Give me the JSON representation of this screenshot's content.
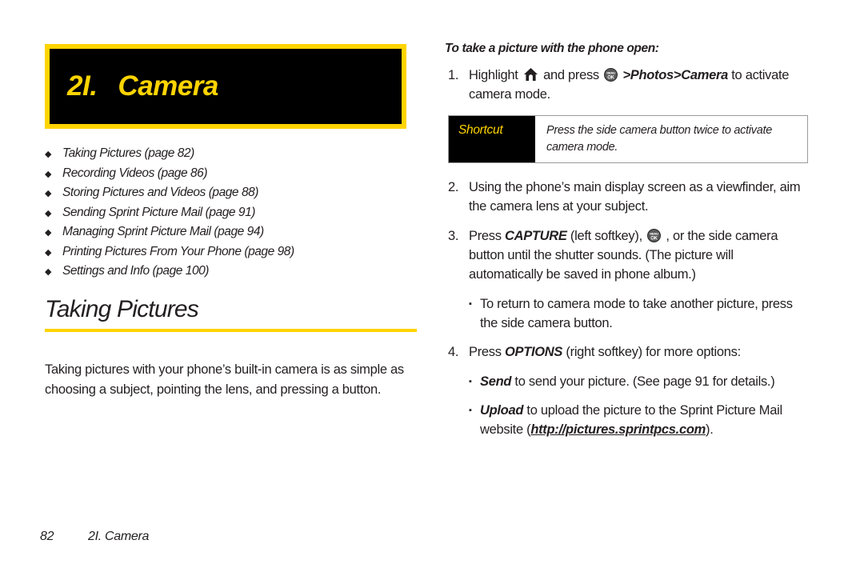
{
  "chapter": {
    "number": "2I.",
    "title": "Camera",
    "banner_bg": "#000000",
    "banner_border": "#FFD400",
    "banner_text_color": "#FFD400"
  },
  "toc": {
    "bullet_glyph": "◆",
    "items": [
      {
        "label": "Taking Pictures (page 82)"
      },
      {
        "label": "Recording Videos (page 86)"
      },
      {
        "label": "Storing Pictures and Videos (page 88)"
      },
      {
        "label": "Sending Sprint Picture Mail (page 91)"
      },
      {
        "label": "Managing Sprint Picture Mail (page 94)"
      },
      {
        "label": "Printing Pictures From Your Phone (page 98)"
      },
      {
        "label": "Settings and Info (page 100)"
      }
    ]
  },
  "section": {
    "title": "Taking Pictures",
    "rule_color": "#FFD400",
    "body": "Taking pictures with your phone’s built-in camera is as simple as choosing a subject, pointing the lens, and pressing a button."
  },
  "procedure": {
    "intro": "To take a picture with the phone open:",
    "steps": [
      {
        "number": "1.",
        "parts": [
          {
            "type": "text",
            "value": "Highlight "
          },
          {
            "type": "icon",
            "value": "home-icon"
          },
          {
            "type": "text",
            "value": " and press "
          },
          {
            "type": "icon",
            "value": "menu-ok-key-icon"
          },
          {
            "type": "text",
            "value": " "
          },
          {
            "type": "italic-bold",
            "value": ">Photos"
          },
          {
            "type": "italic-bold",
            "value": ">Camera"
          },
          {
            "type": "text",
            "value": " to activate camera mode."
          }
        ]
      },
      {
        "number": "2.",
        "parts": [
          {
            "type": "text",
            "value": "Using the phone’s main display screen as a viewfinder, aim the camera lens at your subject."
          }
        ]
      },
      {
        "number": "3.",
        "parts": [
          {
            "type": "text",
            "value": "Press "
          },
          {
            "type": "italic-bold",
            "value": "CAPTURE"
          },
          {
            "type": "text",
            "value": " (left softkey), "
          },
          {
            "type": "icon",
            "value": "menu-ok-key-icon"
          },
          {
            "type": "text",
            "value": " , or the side camera button until the shutter sounds. (The picture will automatically be saved in phone album.)"
          }
        ]
      },
      {
        "number": "4.",
        "parts": [
          {
            "type": "text",
            "value": "Press "
          },
          {
            "type": "italic-bold",
            "value": "OPTIONS"
          },
          {
            "type": "text",
            "value": " (right softkey) for more options:"
          }
        ]
      }
    ],
    "substep_bullet_glyph": "▪",
    "substep_after_3": {
      "text": "To return to camera mode to take another picture, press the side camera button."
    },
    "substeps_after_4": [
      {
        "lead": "Send",
        "text": " to send your picture. (See page 91 for details.)"
      },
      {
        "lead": "Upload",
        "text_before": " to upload the picture to the Sprint Picture Mail website (",
        "url": "http://pictures.sprintpcs.com",
        "text_after": ")."
      }
    ]
  },
  "shortcut": {
    "label": "Shortcut",
    "text": "Press the side camera button twice to activate camera mode.",
    "label_bg": "#000000",
    "label_color": "#FFD400"
  },
  "footer": {
    "page_number": "82",
    "chapter_ref": "2I. Camera"
  }
}
